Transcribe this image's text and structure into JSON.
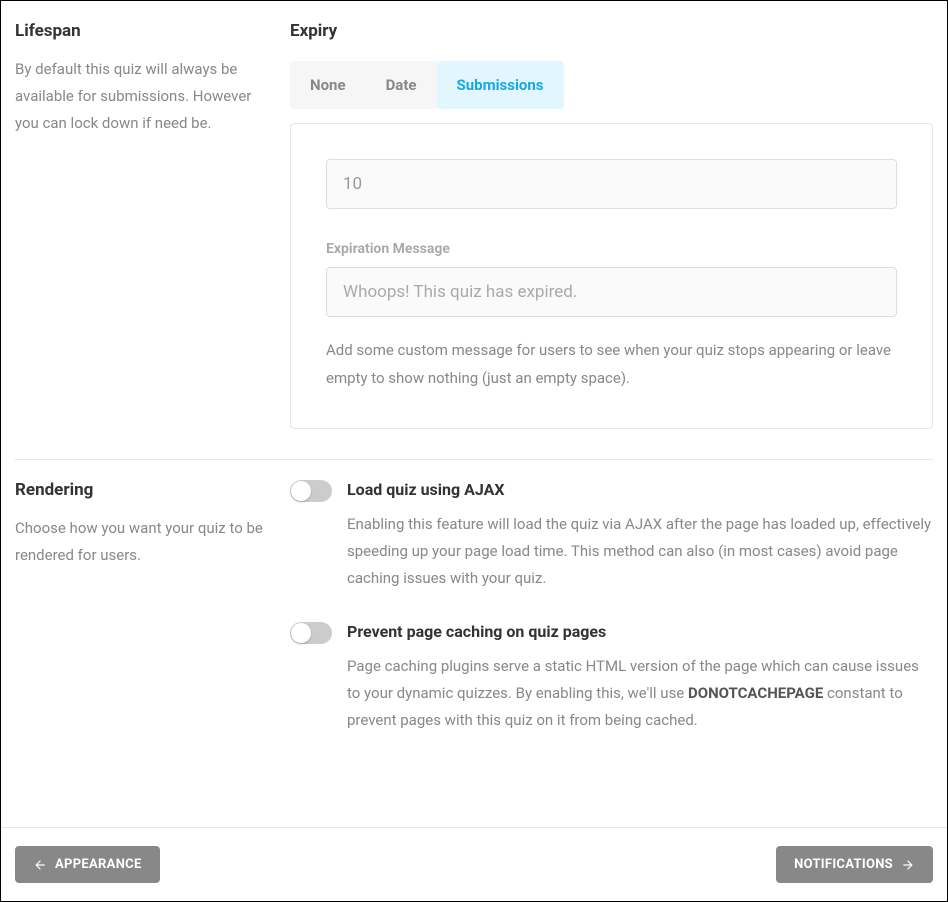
{
  "lifespan": {
    "title": "Lifespan",
    "desc": "By default this quiz will always be available for submissions. However you can lock down if need be.",
    "expiry_title": "Expiry",
    "tabs": {
      "none": "None",
      "date": "Date",
      "submissions": "Submissions"
    },
    "submissions_value": "10",
    "expiration_label": "Expiration Message",
    "expiration_placeholder": "Whoops! This quiz has expired.",
    "expiration_help": "Add some custom message for users to see when your quiz stops appearing or leave empty to show nothing (just an empty space)."
  },
  "rendering": {
    "title": "Rendering",
    "desc": "Choose how you want your quiz to be rendered for users.",
    "ajax_title": "Load quiz using AJAX",
    "ajax_desc": "Enabling this feature will load the quiz via AJAX after the page has loaded up, effectively speeding up your page load time. This method can also (in most cases) avoid page caching issues with your quiz.",
    "cache_title": "Prevent page caching on quiz pages",
    "cache_desc_prefix": "Page caching plugins serve a static HTML version of the page which can cause issues to your dynamic quizzes. By enabling this, we'll use ",
    "cache_desc_bold": "DONOTCACHEPAGE",
    "cache_desc_suffix": " constant to prevent pages with this quiz on it from being cached."
  },
  "footer": {
    "prev": "APPEARANCE",
    "next": "NOTIFICATIONS"
  }
}
